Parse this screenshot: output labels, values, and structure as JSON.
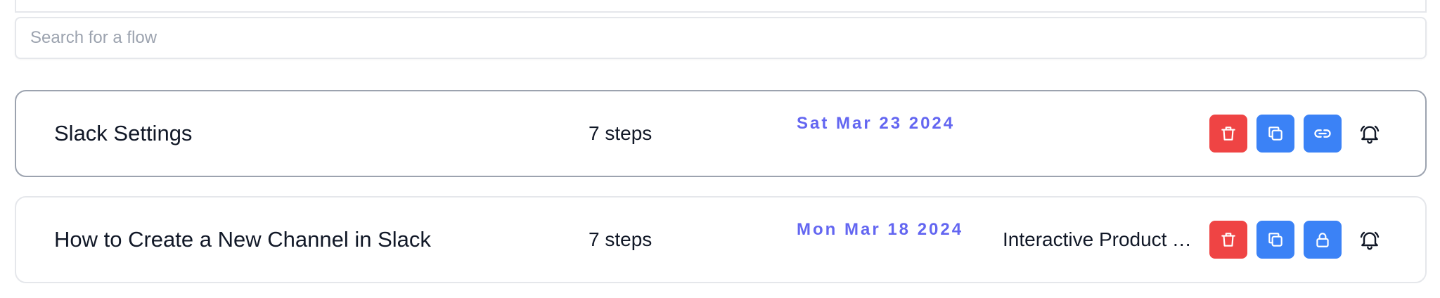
{
  "search": {
    "placeholder": "Search for a flow",
    "value": ""
  },
  "flows": [
    {
      "title": "Slack Settings",
      "steps": "7 steps",
      "date": "Sat Mar 23 2024",
      "type": "",
      "share_icon": "link-icon",
      "selected": true
    },
    {
      "title": "How to Create a New Channel in Slack",
      "steps": "7 steps",
      "date": "Mon Mar 18 2024",
      "type": "Interactive Product Tour",
      "share_icon": "lock-icon",
      "selected": false
    }
  ],
  "icons": {
    "delete": "trash-icon",
    "duplicate": "copy-icon",
    "notifications": "bell-ring-icon"
  },
  "colors": {
    "delete": "#ef4444",
    "action": "#3b82f6",
    "date": "#6366f1",
    "text": "#111827",
    "placeholder": "#9ca3af"
  }
}
